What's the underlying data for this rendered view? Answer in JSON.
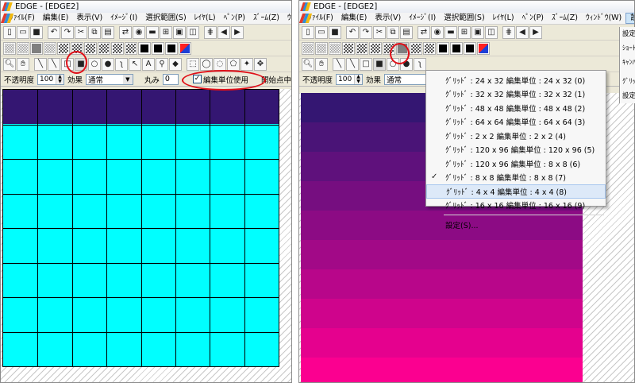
{
  "left_window": {
    "title": "EDGE - [EDGE2]",
    "menu": [
      "ﾌｧｲﾙ(F)",
      "編集(E)",
      "表示(V)",
      "ｲﾒｰｼﾞ(I)",
      "選択範囲(S)",
      "ﾚｲﾔ(L)",
      "ﾍﾟﾝ(P)",
      "ｽﾞｰﾑ(Z)",
      "ｳｨﾝﾄﾞｳ(W)"
    ],
    "options": {
      "opacity_label": "不透明度",
      "opacity_value": "100",
      "effect_label": "効果",
      "effect_value": "通常",
      "round_label": "丸み",
      "round_value": "0",
      "edit_unit_checkbox": "編集単位使用",
      "edit_unit_checked": "✓",
      "start_point_label": "開始点中"
    },
    "canvas_colors": {
      "header": "#341672",
      "body": "#00ffff"
    }
  },
  "right_window": {
    "title": "EDGE - [EDGE2]",
    "menu": [
      "ﾌｧｲﾙ(F)",
      "編集(E)",
      "表示(V)",
      "ｲﾒｰｼﾞ(I)",
      "選択範囲(S)",
      "ﾚｲﾔ(L)",
      "ﾍﾟﾝ(P)",
      "ｽﾞｰﾑ(Z)",
      "ｳｨﾝﾄﾞｳ(W)",
      "設定(T)"
    ],
    "options": {
      "opacity_label": "不透明度",
      "opacity_value": "100",
      "effect_label": "効果",
      "effect_value": "通常"
    },
    "gradient_bands": [
      "#341672",
      "#4a1477",
      "#5f117c",
      "#760e80",
      "#8c0b84",
      "#a20987",
      "#b8068a",
      "#cf048c",
      "#e5018e",
      "#fb0090"
    ],
    "grid_menu": {
      "items": [
        "ｸﾞﾘｯﾄﾞ : 24 x 32  編集単位 : 24 x 32 (0)",
        "ｸﾞﾘｯﾄﾞ : 32 x 32  編集単位 : 32 x 32 (1)",
        "ｸﾞﾘｯﾄﾞ : 48 x 48  編集単位 : 48 x 48 (2)",
        "ｸﾞﾘｯﾄﾞ : 64 x 64  編集単位 : 64 x 64 (3)",
        "ｸﾞﾘｯﾄﾞ : 2 x 2  編集単位 : 2 x 2 (4)",
        "ｸﾞﾘｯﾄﾞ : 120 x 96  編集単位 : 120 x 96 (5)",
        "ｸﾞﾘｯﾄﾞ : 120 x 96  編集単位 : 8 x 8 (6)",
        "ｸﾞﾘｯﾄﾞ : 8 x 8  編集単位 : 8 x 8 (7)",
        "ｸﾞﾘｯﾄﾞ : 4 x 4  編集単位 : 4 x 4 (8)",
        "ｸﾞﾘｯﾄﾞ : 16 x 16  編集単位 : 16 x 16 (9)"
      ],
      "checked_mark": "✓",
      "settings": "設定(S)..."
    },
    "settings_menu": [
      "設定",
      "ｼｮｰﾄ",
      "ｷｬﾝﾊﾞ",
      "ｸﾞﾘｯ",
      "設定"
    ]
  },
  "colors": {
    "highlight_ring": "#e01018"
  }
}
